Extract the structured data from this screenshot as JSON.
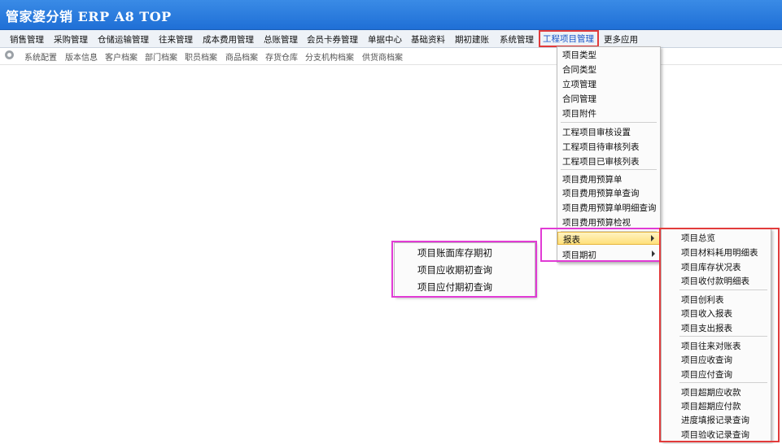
{
  "app": {
    "title": "管家婆分销 ERP A8 TOP"
  },
  "menubar": {
    "items": [
      "销售管理",
      "采购管理",
      "仓储运输管理",
      "往来管理",
      "成本费用管理",
      "总账管理",
      "会员卡券管理",
      "单据中心",
      "基础资料",
      "期初建账",
      "系统管理",
      "工程项目管理",
      "更多应用"
    ],
    "active": "工程项目管理"
  },
  "subbar": {
    "items": [
      "系统配置",
      "版本信息",
      "客户档案",
      "部门档案",
      "职员档案",
      "商品档案",
      "存货仓库",
      "分支机构档案",
      "供货商档案"
    ]
  },
  "project_menu": {
    "groups": [
      [
        "项目类型",
        "合同类型",
        "立项管理",
        "合同管理",
        "项目附件"
      ],
      [
        "工程项目审核设置",
        "工程项目待审核列表",
        "工程项目已审核列表"
      ],
      [
        "项目费用预算单",
        "项目费用预算单查询",
        "项目费用预算单明细查询",
        "项目费用预算检视"
      ]
    ],
    "report_label": "报表",
    "opening_label": "项目期初"
  },
  "report_submenu": {
    "groups": [
      [
        "项目总览",
        "项目材料耗用明细表",
        "项目库存状况表",
        "项目收付款明细表"
      ],
      [
        "项目创利表",
        "项目收入报表",
        "项目支出报表"
      ],
      [
        "项目往来对账表",
        "项目应收查询",
        "项目应付查询"
      ],
      [
        "项目超期应收款",
        "项目超期应付款",
        "进度填报记录查询",
        "项目验收记录查询"
      ]
    ]
  },
  "opening_submenu": {
    "items": [
      "项目账面库存期初",
      "项目应收期初查询",
      "项目应付期初查询"
    ]
  },
  "colors": {
    "title_bar": "#1f6fd6",
    "highlight_red": "#e23b3b",
    "highlight_magenta": "#e13bd5"
  }
}
